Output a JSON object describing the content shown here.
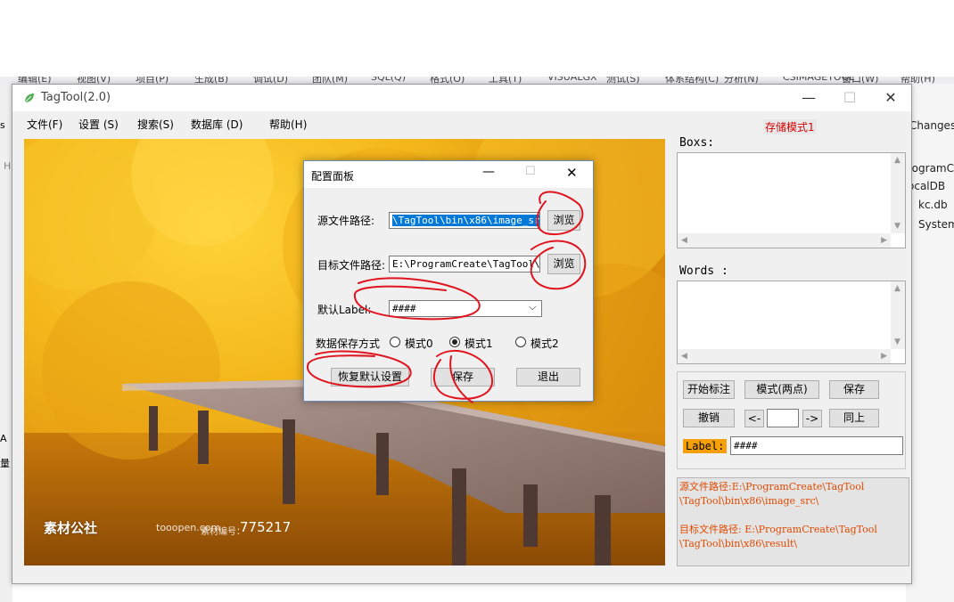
{
  "background": {
    "menu_items": [
      "编辑(E)",
      "视图(V)",
      "项目(P)",
      "生成(B)",
      "调试(D)",
      "团队(M)",
      "SQL(Q)",
      "格式(O)",
      "工具(T)",
      "VISUALGX",
      "测试(S)",
      "体系结构(C)",
      "分析(N)",
      "CSIMAGETOOL",
      "窗口(W)",
      "帮助(H)"
    ],
    "right_items": [
      "Changes",
      "rogramC",
      "ocalDB",
      "kc.db",
      "System"
    ],
    "left_letters": [
      "s",
      "a",
      "H",
      "A",
      "量"
    ]
  },
  "window": {
    "title": "TagTool(2.0)",
    "minimize_glyph": "—",
    "maximize_glyph": "☐",
    "close_glyph": "✕"
  },
  "menu": {
    "items": [
      "文件(F)",
      "设置 (S)",
      "搜索(S)",
      "数据库 (D)",
      "帮助(H)"
    ],
    "mode_label": "存储模式1"
  },
  "image": {
    "watermark_brand": "素材公社",
    "watermark_site": "tooopen.com",
    "watermark_label": "素材编号：",
    "watermark_number": "775217"
  },
  "right": {
    "boxs_label": "Boxs:",
    "words_label": "Words :",
    "btn_start": "开始标注",
    "btn_mode": "模式(两点)",
    "btn_save": "保存",
    "btn_undo": "撤销",
    "btn_prev": "<-",
    "nav_value": "",
    "btn_next": "->",
    "btn_same": "同上",
    "label_tag": "Label:",
    "label_value": "####",
    "log_lines": [
      "源文件路径:E:\\ProgramCreate\\TagTool",
      "\\TagTool\\bin\\x86\\image_src\\",
      "",
      "目标文件路径: E:\\ProgramCreate\\TagTool",
      "\\TagTool\\bin\\x86\\result\\"
    ]
  },
  "dialog": {
    "title": "配置面板",
    "source_label": "源文件路径:",
    "source_value": "\\TagTool\\bin\\x86\\image_src\\",
    "browse1": "浏览",
    "target_label": "目标文件路径:",
    "target_value": "E:\\ProgramCreate\\TagTool\\Tag",
    "browse2": "浏览",
    "default_label": "默认Label:",
    "default_value": "####",
    "save_mode_label": "数据保存方式",
    "mode0": "模式0",
    "mode1": "模式1",
    "mode2": "模式2",
    "selected_mode": "模式1",
    "btn_restore": "恢复默认设置",
    "btn_save": "保存",
    "btn_exit": "退出"
  },
  "colors": {
    "annotation_red": "#e0141e",
    "log_text": "#e04a00",
    "label_tag_bg": "#f5a00a",
    "mode_label": "#d40000"
  }
}
